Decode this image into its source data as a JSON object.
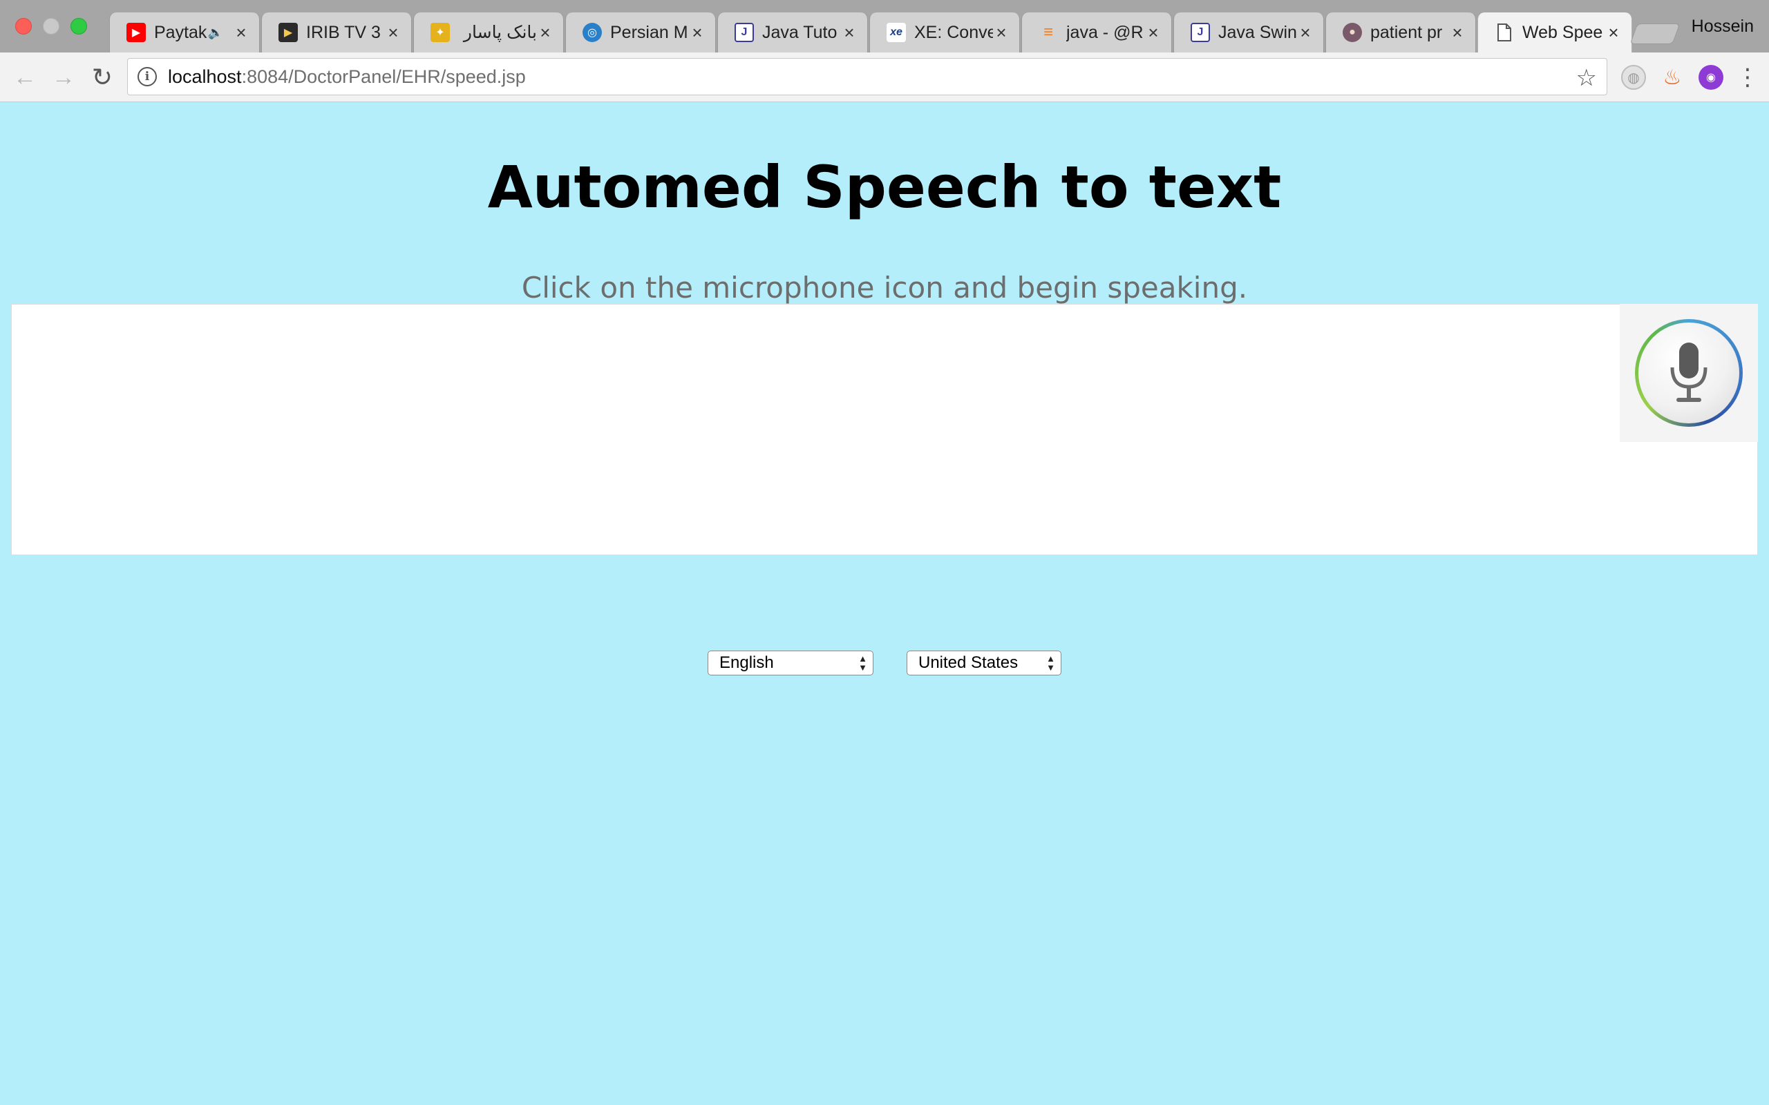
{
  "window": {
    "profile_name": "Hossein"
  },
  "tabs": [
    {
      "title": "Paytakht",
      "favicon": "youtube-icon",
      "color": "#ff0000",
      "glyph": "▶",
      "audio": "🔈"
    },
    {
      "title": "IRIB TV 3",
      "favicon": "play-icon",
      "color": "#2b2b2b",
      "glyph": "▶"
    },
    {
      "title": "بانک پاسار ::",
      "favicon": "bank-icon",
      "color": "#e6b21c",
      "glyph": "✦"
    },
    {
      "title": "Persian M",
      "favicon": "globe-icon",
      "color": "#2a7fc9",
      "glyph": "◎"
    },
    {
      "title": "Java Tuto",
      "favicon": "javatpoint-icon",
      "color": "#3b3b9c",
      "glyph": "J"
    },
    {
      "title": "XE: Conve",
      "favicon": "xe-icon",
      "color": "#1a3f8f",
      "glyph": "xe"
    },
    {
      "title": "java - @R",
      "favicon": "stackoverflow-icon",
      "color": "#f48024",
      "glyph": "≡"
    },
    {
      "title": "Java Swin",
      "favicon": "javatpoint-icon",
      "color": "#3b3b9c",
      "glyph": "J"
    },
    {
      "title": "patient pr",
      "favicon": "avatar-icon",
      "color": "#7a5a6a",
      "glyph": "●"
    },
    {
      "title": "Web Spee",
      "favicon": "page-icon",
      "color": "#ffffff",
      "glyph": ""
    }
  ],
  "toolbar": {
    "url_host": "localhost",
    "url_rest": ":8084/DoctorPanel/EHR/speed.jsp"
  },
  "page": {
    "title": "Automed Speech to text",
    "hint": "Click on the microphone icon and begin speaking.",
    "language_select": {
      "selected": "English"
    },
    "dialect_select": {
      "selected": "United States"
    }
  },
  "icons": {
    "back": "arrow-left-icon",
    "forward": "arrow-right-icon",
    "reload": "reload-icon",
    "info": "info-icon",
    "star": "star-icon",
    "mic": "microphone-icon"
  }
}
